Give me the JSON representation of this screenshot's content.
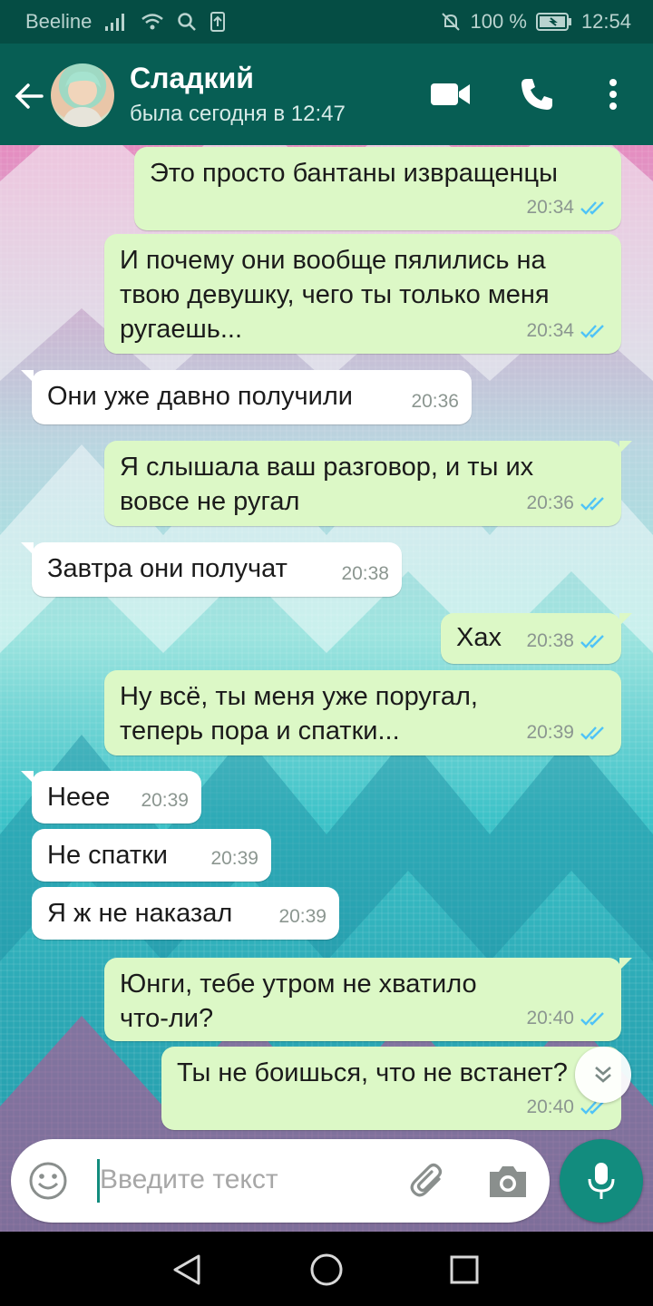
{
  "status_bar": {
    "carrier": "Beeline",
    "battery": "100 %",
    "time": "12:54"
  },
  "header": {
    "contact_name": "Сладкий",
    "last_seen": "была сегодня в 12:47"
  },
  "messages": [
    {
      "dir": "out",
      "lines": [
        "Это просто бантаны извращенцы"
      ],
      "time": "20:34"
    },
    {
      "dir": "out",
      "lines": [
        "И почему они вообще пялились на",
        "твою девушку, чего ты только меня",
        "ругаешь..."
      ],
      "time": "20:34"
    },
    {
      "dir": "in",
      "lines": [
        "Они уже давно получили"
      ],
      "time": "20:36"
    },
    {
      "dir": "out",
      "lines": [
        "Я слышала ваш разговор, и ты их",
        "вовсе не ругал"
      ],
      "time": "20:36"
    },
    {
      "dir": "in",
      "lines": [
        "Завтра они получат"
      ],
      "time": "20:38"
    },
    {
      "dir": "out",
      "lines": [
        "Хах"
      ],
      "time": "20:38"
    },
    {
      "dir": "out",
      "lines": [
        "Ну всё, ты меня уже поругал,",
        "теперь пора и спатки..."
      ],
      "time": "20:39"
    },
    {
      "dir": "in",
      "lines": [
        "Неее"
      ],
      "time": "20:39"
    },
    {
      "dir": "in",
      "lines": [
        "Не спатки"
      ],
      "time": "20:39"
    },
    {
      "dir": "in",
      "lines": [
        "Я ж не наказал"
      ],
      "time": "20:39"
    },
    {
      "dir": "out",
      "lines": [
        "Юнги, тебе утром не хватило",
        "что-ли?"
      ],
      "time": "20:40"
    },
    {
      "dir": "out",
      "lines": [
        "Ты не боишься, что не встанет?"
      ],
      "time": "20:40"
    }
  ],
  "input": {
    "placeholder": "Введите текст"
  },
  "icons": {
    "back": "arrow-left-icon",
    "video": "video-camera-icon",
    "call": "phone-icon",
    "menu": "more-vertical-icon",
    "emoji": "emoji-icon",
    "attach": "paperclip-icon",
    "camera": "camera-icon",
    "mic": "microphone-icon",
    "scroll": "chevron-double-down-icon"
  },
  "colors": {
    "header": "#075e54",
    "status_bar": "#054d44",
    "outgoing_bubble": "#dcf8c6",
    "incoming_bubble": "#ffffff",
    "read_ticks": "#4fc3f7",
    "accent": "#128c7e"
  }
}
